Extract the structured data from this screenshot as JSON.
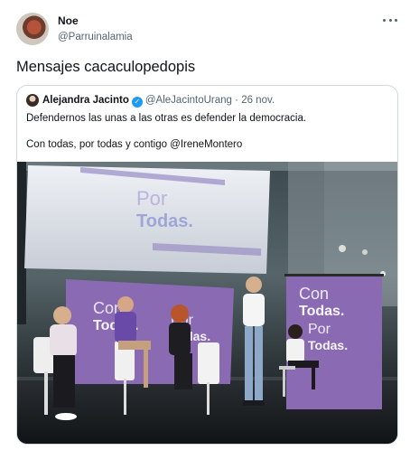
{
  "tweet": {
    "author_name": "Noe",
    "author_handle": "@Parruinalamia",
    "text": "Mensajes cacaculopedopis",
    "more_icon": "more-horizontal-icon"
  },
  "quote": {
    "author_name": "Alejandra Jacinto",
    "verified_icon": "verified-badge-icon",
    "author_handle": "@AleJacintoUrang",
    "separator": "·",
    "date": "26 nov.",
    "line1": "Defendernos las unas a las otras es defender la democracia.",
    "line2": "Con todas, por todas y contigo @IreneMontero",
    "media": {
      "screen_text_1": "Por",
      "screen_text_2": "Todas.",
      "banner_left_1": "Con",
      "banner_left_2": "Todas.",
      "banner_left_3": "Por",
      "banner_left_4": "Todas.",
      "banner_right_1": "Con",
      "banner_right_2": "Todas.",
      "banner_right_3": "Por",
      "banner_right_4": "Todas.",
      "brand_purple": "#8a6bb3"
    }
  }
}
